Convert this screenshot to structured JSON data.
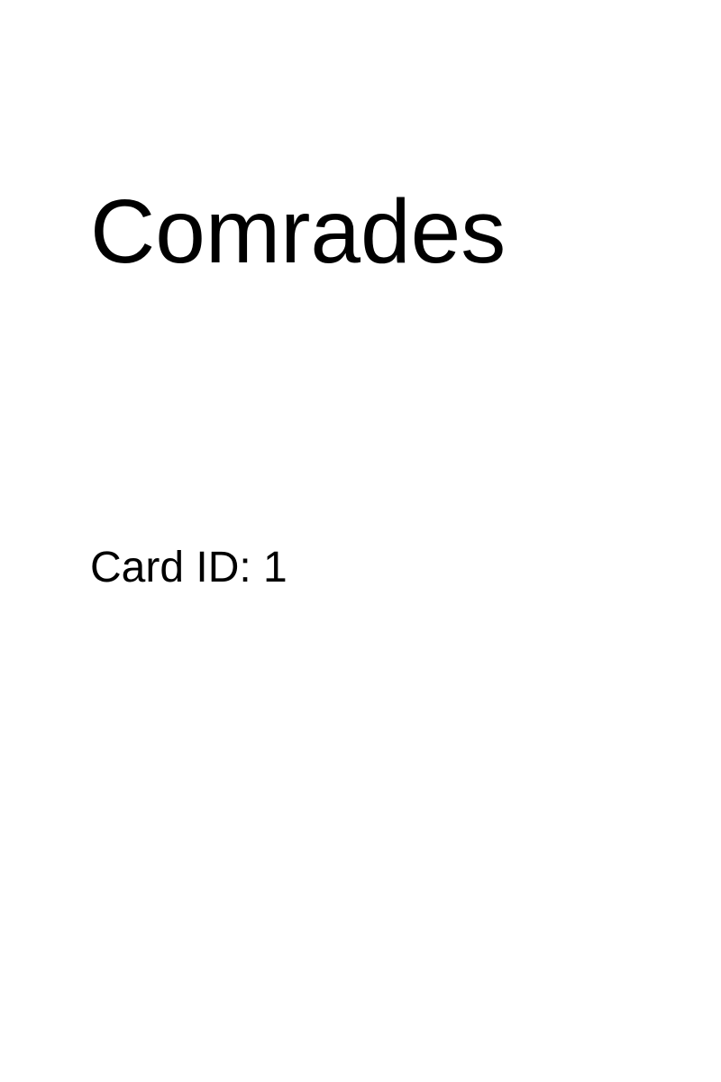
{
  "card": {
    "title": "Comrades",
    "id_line": "Card ID: 1"
  }
}
